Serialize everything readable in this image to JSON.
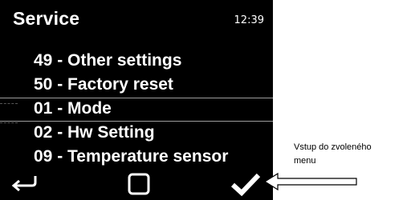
{
  "screen": {
    "title": "Service",
    "time": "12:39",
    "menu_items": [
      {
        "label": "49 - Other settings",
        "selected": false
      },
      {
        "label": "50 - Factory reset",
        "selected": false
      },
      {
        "label": "01 - Mode",
        "selected": true
      },
      {
        "label": "02 - Hw Setting",
        "selected": false
      },
      {
        "label": "09 - Temperature sensor",
        "selected": false
      }
    ],
    "softkeys": {
      "back_icon": "back-arrow-icon",
      "middle_icon": "square-icon",
      "confirm_icon": "checkmark-icon"
    }
  },
  "annotation": {
    "text_line1": "Vstup do zvoleného",
    "text_line2": "menu"
  }
}
